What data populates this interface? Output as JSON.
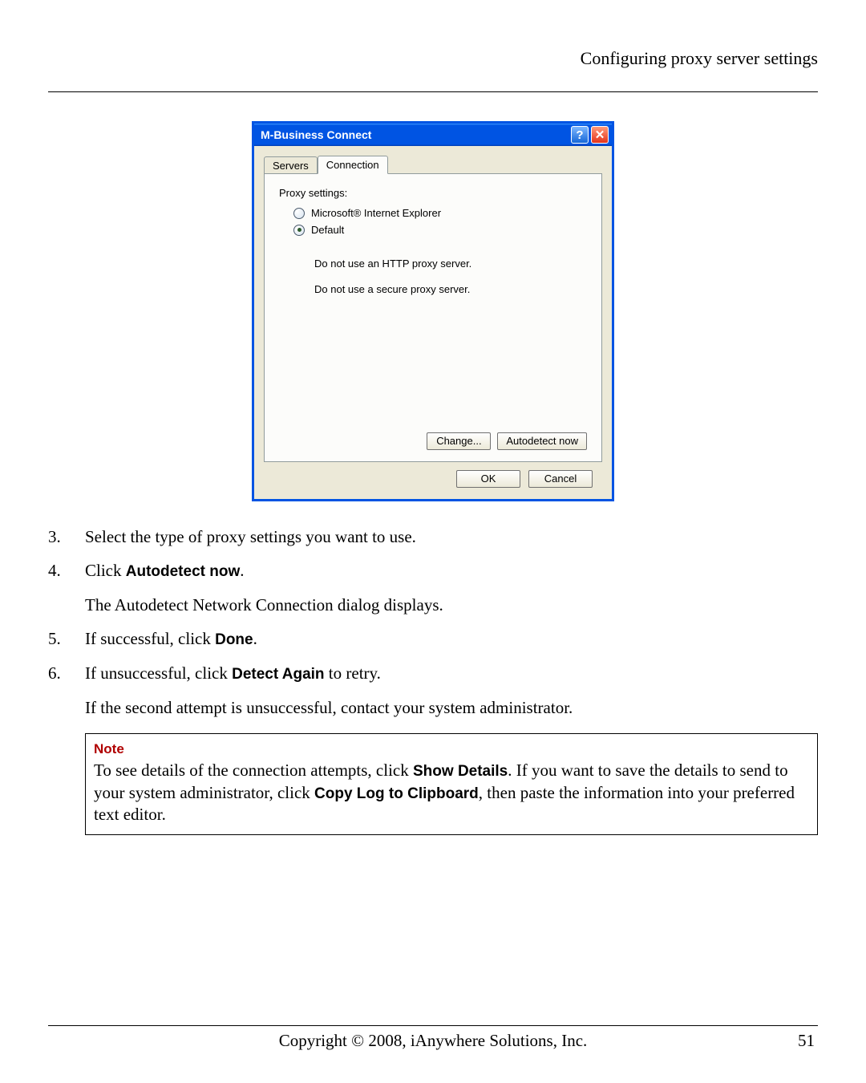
{
  "header": {
    "title": "Configuring proxy server settings"
  },
  "dialog": {
    "title": "M-Business Connect",
    "tabs": {
      "servers": "Servers",
      "connection": "Connection"
    },
    "section_label": "Proxy settings:",
    "radio_ie": "Microsoft® Internet Explorer",
    "radio_default": "Default",
    "info1": "Do not use an HTTP proxy server.",
    "info2": "Do not use a secure proxy server.",
    "change_btn": "Change...",
    "autodetect_btn": "Autodetect now",
    "ok_btn": "OK",
    "cancel_btn": "Cancel"
  },
  "steps": {
    "s3": "Select the type of proxy settings you want to use.",
    "s4a": "Click ",
    "s4b": "Autodetect now",
    "s4c": ".",
    "s4_sub": "The Autodetect Network Connection dialog displays.",
    "s5a": "If successful, click ",
    "s5b": "Done",
    "s5c": ".",
    "s6a": "If unsuccessful, click ",
    "s6b": "Detect Again",
    "s6c": " to retry.",
    "s6_sub": "If the second attempt is unsuccessful, contact your system administrator."
  },
  "note": {
    "title": "Note",
    "t1": "To see details of the connection attempts, click ",
    "b1": "Show Details",
    "t2": ". If you want to save the details to send to your system administrator, click ",
    "b2": "Copy Log to Clipboard",
    "t3": ", then paste the information into your preferred text editor."
  },
  "footer": {
    "copyright": "Copyright © 2008, iAnywhere Solutions, Inc.",
    "page": "51"
  }
}
